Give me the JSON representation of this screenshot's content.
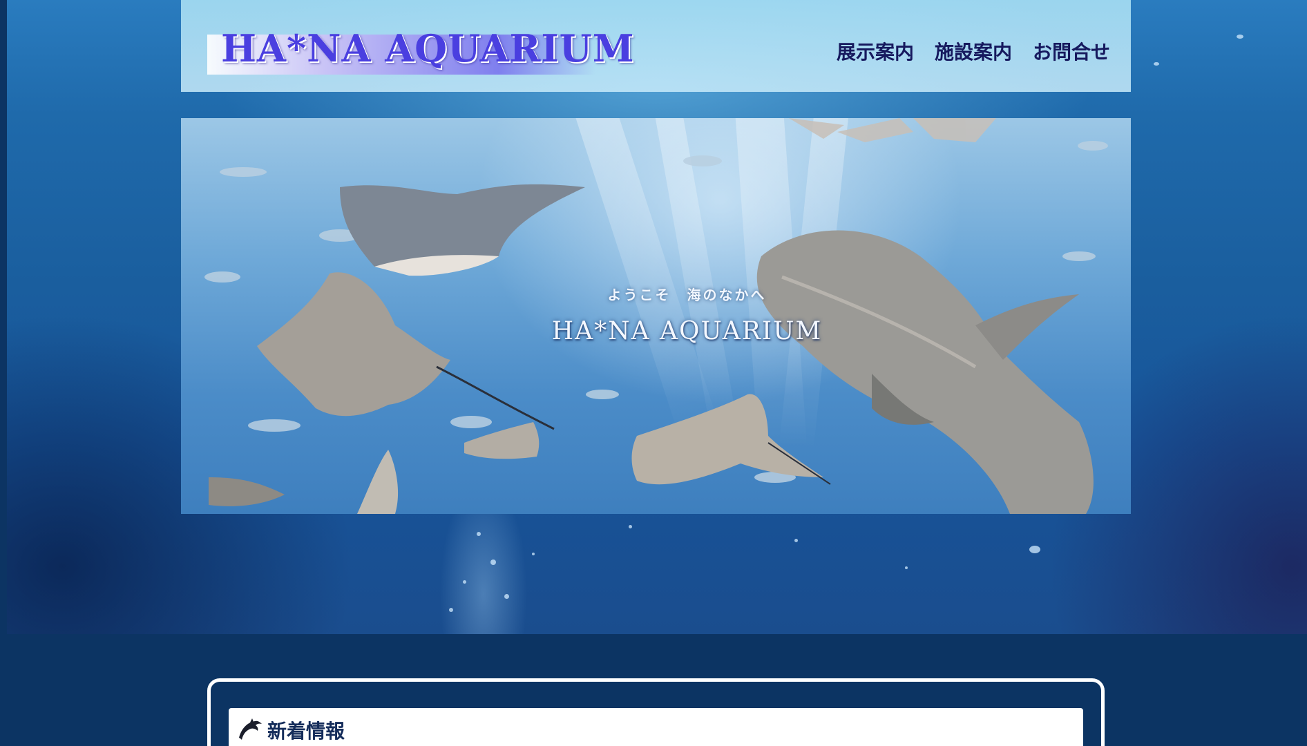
{
  "site": {
    "logo": "HA*NA AQUARIUM"
  },
  "nav": {
    "items": [
      {
        "label": "展示案内"
      },
      {
        "label": "施設案内"
      },
      {
        "label": "お問合せ"
      }
    ]
  },
  "hero": {
    "subtitle": "ようこそ　海のなかへ",
    "title": "HA*NA AQUARIUM"
  },
  "news": {
    "heading": "新着情報",
    "icon": "dolphin-icon"
  },
  "colors": {
    "page_background": "#0c3463",
    "logo_text": "#4a3fe0",
    "nav_text": "#16195e",
    "news_heading": "#142c5a"
  }
}
